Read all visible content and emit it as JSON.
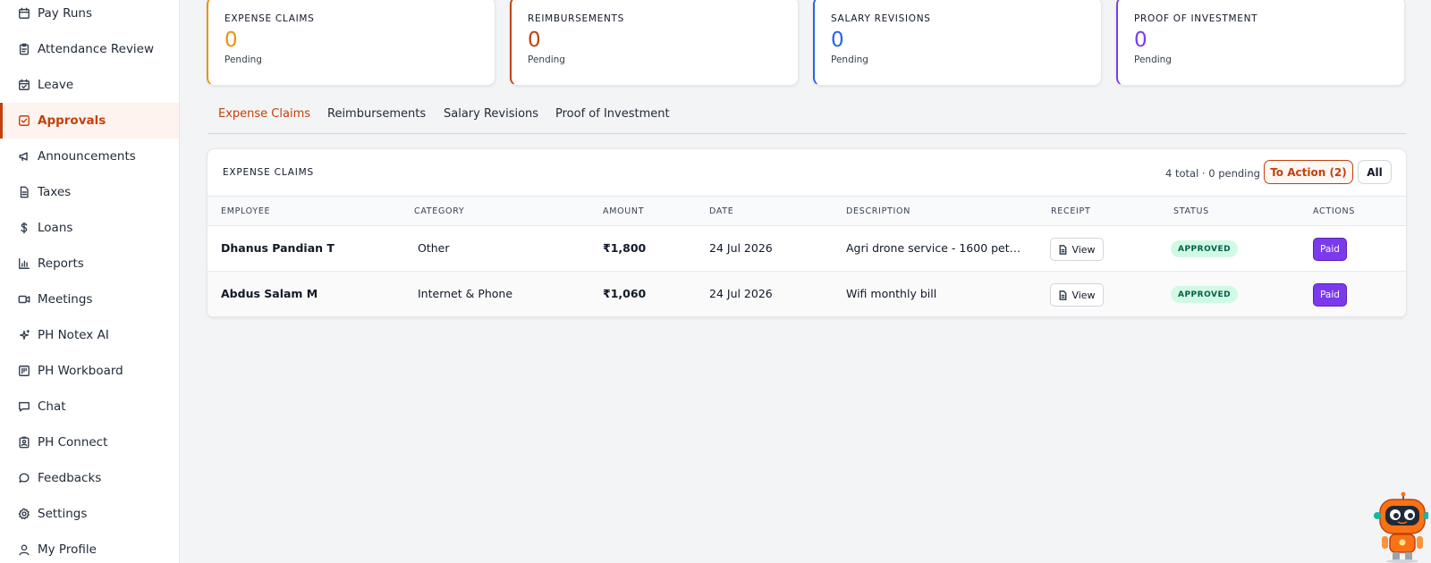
{
  "sidebar": {
    "items": [
      {
        "label": "Pay Runs",
        "icon": "calendar-icon"
      },
      {
        "label": "Attendance Review",
        "icon": "clipboard-icon"
      },
      {
        "label": "Leave",
        "icon": "calendar-check-icon"
      },
      {
        "label": "Approvals",
        "icon": "checkbox-icon",
        "active": true
      },
      {
        "label": "Announcements",
        "icon": "megaphone-icon"
      },
      {
        "label": "Taxes",
        "icon": "document-icon"
      },
      {
        "label": "Loans",
        "icon": "dollar-icon"
      },
      {
        "label": "Reports",
        "icon": "bar-chart-icon"
      },
      {
        "label": "Meetings",
        "icon": "video-icon"
      },
      {
        "label": "PH Notex AI",
        "icon": "sparkles-icon"
      },
      {
        "label": "PH Workboard",
        "icon": "kanban-icon"
      },
      {
        "label": "Chat",
        "icon": "chat-icon"
      },
      {
        "label": "PH Connect",
        "icon": "contact-card-icon"
      },
      {
        "label": "Feedbacks",
        "icon": "message-circle-icon"
      },
      {
        "label": "Settings",
        "icon": "gear-icon"
      },
      {
        "label": "My Profile",
        "icon": "user-icon"
      }
    ]
  },
  "cards": [
    {
      "title": "EXPENSE CLAIMS",
      "count": "0",
      "sub": "Pending",
      "color": "#e8940c"
    },
    {
      "title": "REIMBURSEMENTS",
      "count": "0",
      "sub": "Pending",
      "color": "#c2410c"
    },
    {
      "title": "SALARY REVISIONS",
      "count": "0",
      "sub": "Pending",
      "color": "#2563eb"
    },
    {
      "title": "PROOF OF INVESTMENT",
      "count": "0",
      "sub": "Pending",
      "color": "#7c3aed"
    }
  ],
  "tabs": [
    "Expense Claims",
    "Reimbursements",
    "Salary Revisions",
    "Proof of Investment"
  ],
  "panel": {
    "title": "EXPENSE CLAIMS",
    "meta": "4 total · 0 pending",
    "to_action_label": "To Action (2)",
    "all_label": "All"
  },
  "table": {
    "headers": [
      "EMPLOYEE",
      "CATEGORY",
      "AMOUNT",
      "DATE",
      "DESCRIPTION",
      "RECEIPT",
      "STATUS",
      "ACTIONS"
    ],
    "rows": [
      {
        "employee": "Dhanus Pandian T",
        "category": "Other",
        "amount": "₹1,800",
        "date": "24 Jul 2026",
        "description": "Agri drone service - 1600 petrol...",
        "receipt": "View",
        "status": "APPROVED",
        "action": "Paid"
      },
      {
        "employee": "Abdus Salam M",
        "category": "Internet & Phone",
        "amount": "₹1,060",
        "date": "24 Jul 2026",
        "description": "Wifi monthly bill",
        "receipt": "View",
        "status": "APPROVED",
        "action": "Paid"
      }
    ]
  },
  "colors": {
    "accent": "#c2410c",
    "paid": "#7c3aed",
    "approved_bg": "#d1fae5"
  }
}
